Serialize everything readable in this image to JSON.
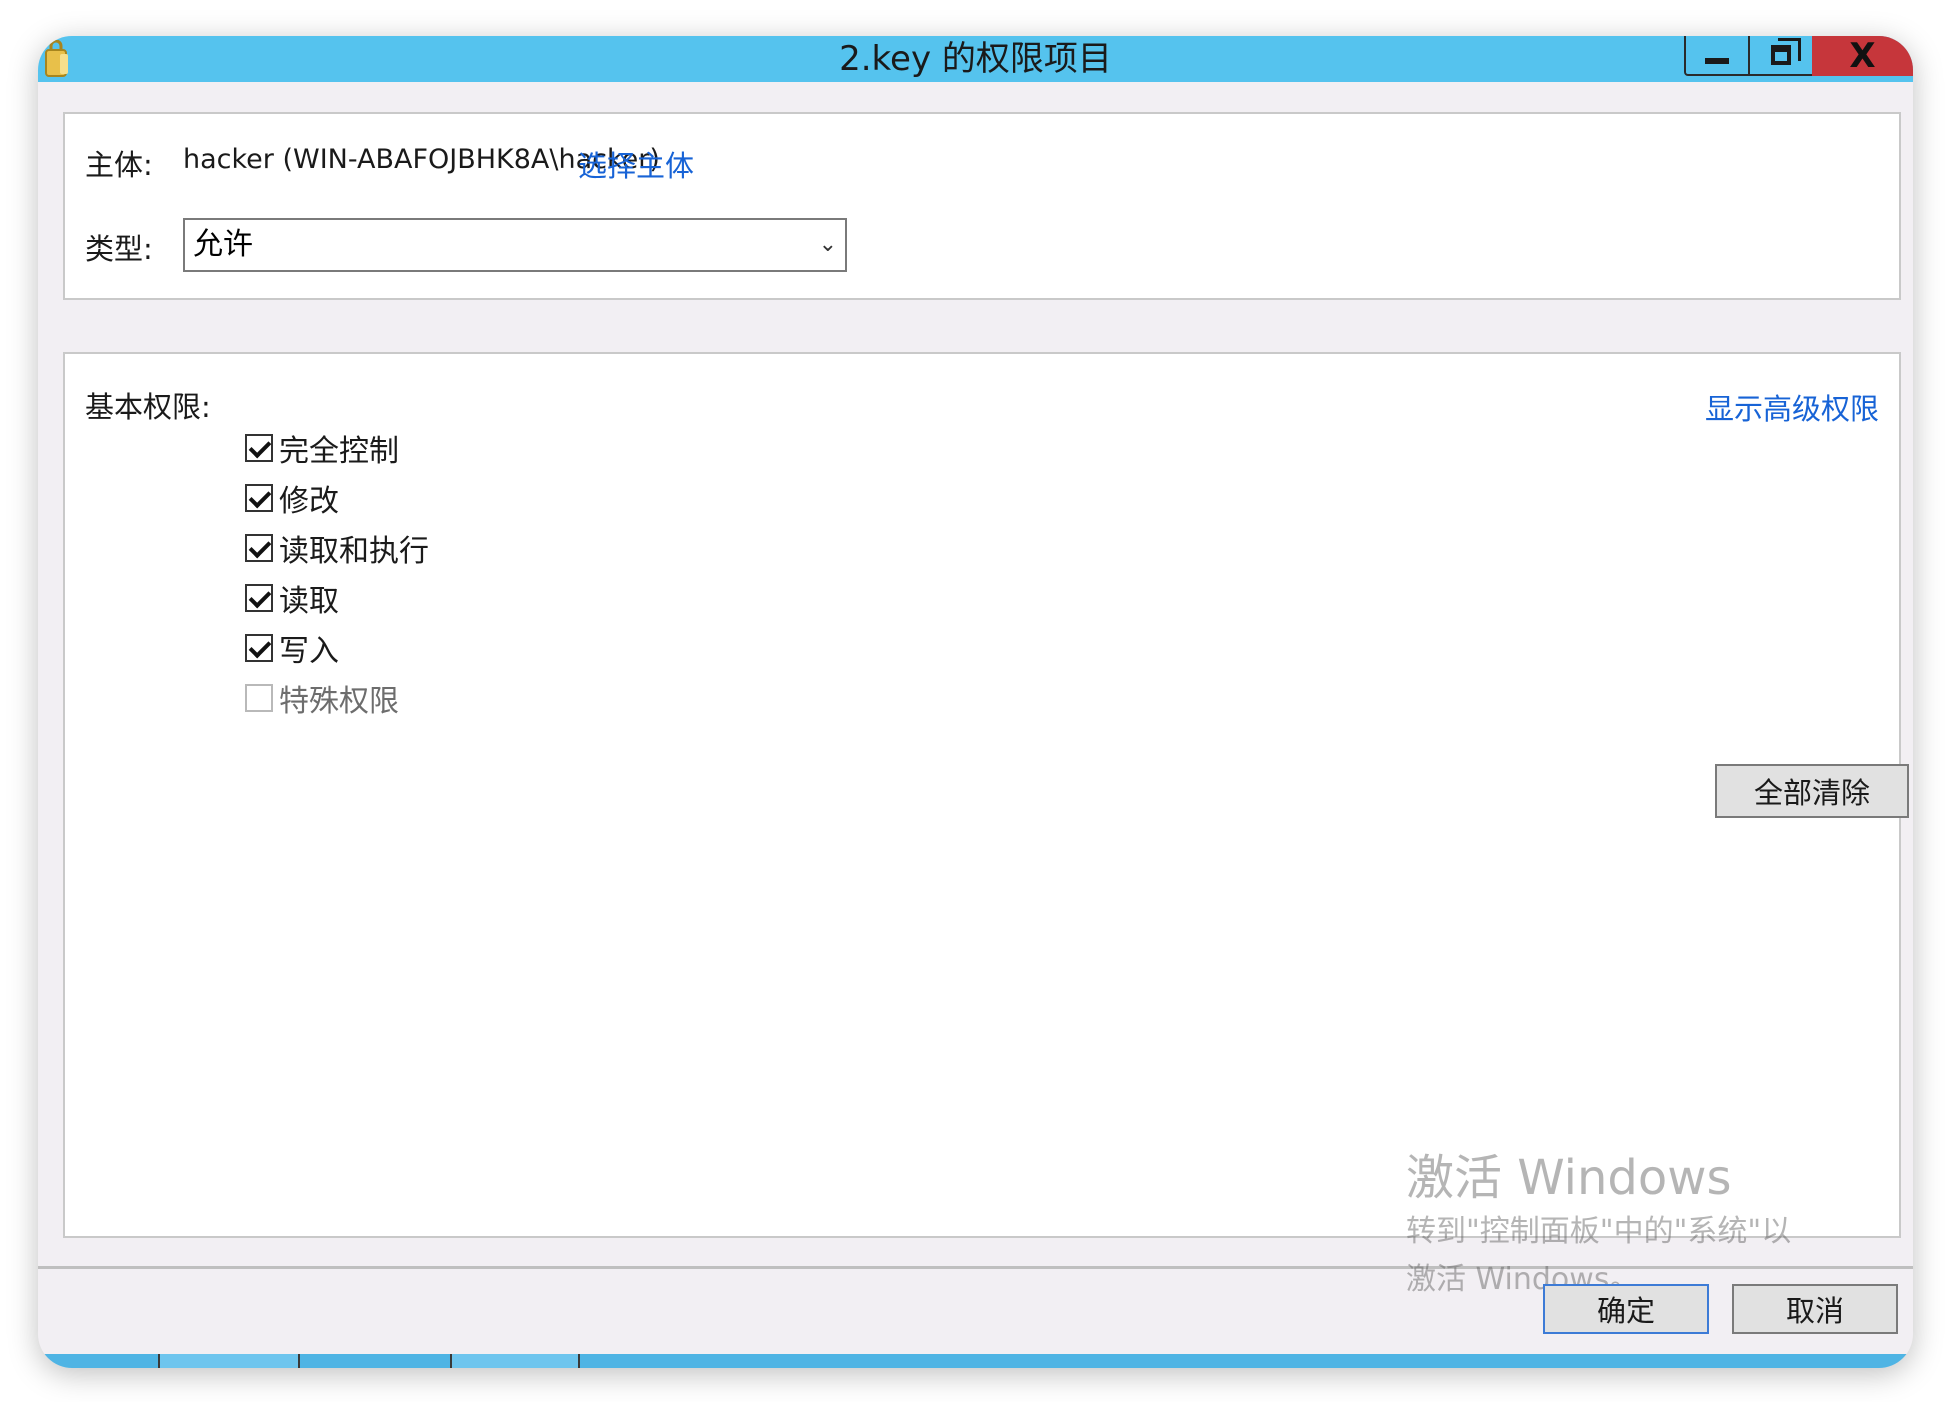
{
  "window": {
    "title": "2.key 的权限项目",
    "icons": {
      "app": "folder-lock-icon",
      "minimize": "minimize-icon",
      "maximize": "restore-icon",
      "close": "close-icon"
    },
    "close_glyph": "X"
  },
  "principal": {
    "label": "主体:",
    "value": "hacker (WIN-ABAFOJBHK8A\\hacker)",
    "select_link": "选择主体"
  },
  "type": {
    "label": "类型:",
    "value": "允许",
    "arrow_icon": "chevron-down-icon"
  },
  "permissions": {
    "heading": "基本权限:",
    "advanced_link": "显示高级权限",
    "items": [
      {
        "label": "完全控制",
        "checked": true,
        "enabled": true
      },
      {
        "label": "修改",
        "checked": true,
        "enabled": true
      },
      {
        "label": "读取和执行",
        "checked": true,
        "enabled": true
      },
      {
        "label": "读取",
        "checked": true,
        "enabled": true
      },
      {
        "label": "写入",
        "checked": true,
        "enabled": true
      },
      {
        "label": "特殊权限",
        "checked": false,
        "enabled": false
      }
    ],
    "clear_all": "全部清除"
  },
  "watermark": {
    "line1": "激活 Windows",
    "line2": "转到\"控制面板\"中的\"系统\"以",
    "line3": "激活 Windows。"
  },
  "footer": {
    "ok": "确定",
    "cancel": "取消"
  },
  "colors": {
    "titlebar": "#55c3ee",
    "close": "#c6363b",
    "link": "#1763d6"
  }
}
